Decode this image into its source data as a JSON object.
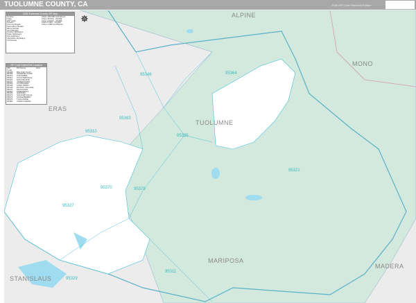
{
  "header": {
    "title": "TUOLUMNE COUNTY, CA",
    "edition": "2026 ZIP Code Premium Edition"
  },
  "legend": {
    "title": "2026 Tuolumne County ZIP Map",
    "items": [
      "County",
      "State",
      "ZIP Code",
      "Stream",
      "Primary Roads",
      "Secondary Roads",
      "Minor Roads",
      "Land Bodies",
      "County Highways",
      "State Highways",
      "US Highways",
      "Interstate Highways",
      "Toll Roads"
    ],
    "pop_classes": [
      "Cities 100,000 and Above",
      "Cities 50,000 - 99,999",
      "Cities 20,000 - 49,999",
      "Cities 5,000 - 19,999",
      "Cities 4,999 and Below"
    ]
  },
  "zip_table": {
    "title": "ZIP Code Index/Grid Location",
    "headers": [
      "ZIP Code",
      "PO Name",
      "Grid"
    ],
    "rows": [
      [
        "95305",
        "BIG OAK FLAT",
        ""
      ],
      [
        "95309",
        "CHINESE CAMP",
        ""
      ],
      [
        "95310",
        "COLUMBIA",
        ""
      ],
      [
        "95311",
        "COULTERVILLE",
        ""
      ],
      [
        "95321",
        "GROVELAND",
        ""
      ],
      [
        "95327",
        "JAMESTOWN",
        ""
      ],
      [
        "95329",
        "LA GRANGE",
        ""
      ],
      [
        "95335",
        "LONG BARN",
        ""
      ],
      [
        "95346",
        "MI WUK VILLAGE",
        ""
      ],
      [
        "95347",
        "MOCCASIN",
        ""
      ],
      [
        "95364",
        "PINECREST",
        ""
      ],
      [
        "95370",
        "SONORA",
        ""
      ],
      [
        "95372",
        "SOULSBYVILLE",
        ""
      ],
      [
        "95375",
        "STRAWBERRY",
        ""
      ],
      [
        "95379",
        "TUOLUMNE",
        ""
      ],
      [
        "95383",
        "TWAIN HARTE",
        ""
      ]
    ]
  },
  "zip_labels": [
    "95346",
    "95364",
    "95383",
    "95310",
    "95335",
    "95370",
    "95379",
    "95327",
    "95321",
    "95329",
    "95311"
  ],
  "county_labels": [
    "ALPINE",
    "MONO",
    "TUOLUMNE",
    "MARIPOSA",
    "MADERA",
    "STANISLAUS",
    "ERAS"
  ],
  "colors": {
    "forest": "#d3e9dd",
    "zip_line": "#46c1d8",
    "water": "#9fdcef",
    "county_line": "#5ab0c8",
    "outside": "#e8e8e8"
  }
}
